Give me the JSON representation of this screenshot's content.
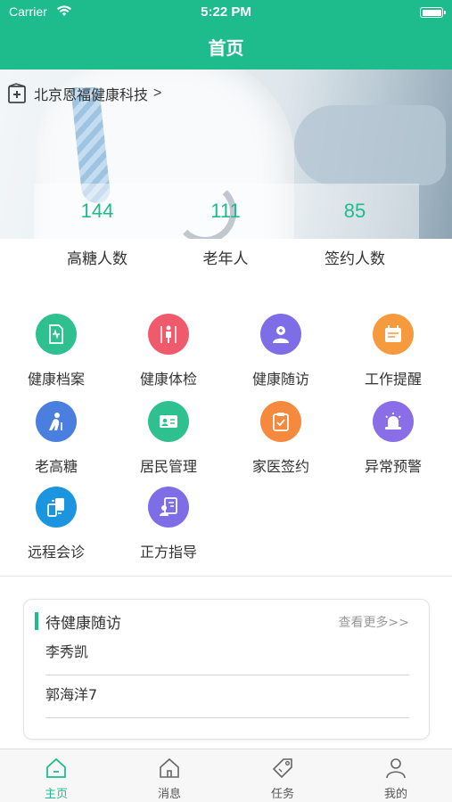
{
  "status": {
    "carrier": "Carrier",
    "time": "5:22 PM"
  },
  "nav": {
    "title": "首页"
  },
  "banner": {
    "org_name": "北京恩福健康科技",
    "org_arrow": ">",
    "stats": [
      {
        "value": "144",
        "label": "高糖人数"
      },
      {
        "value": "111",
        "label": "老年人"
      },
      {
        "value": "85",
        "label": "签约人数"
      }
    ]
  },
  "grid": [
    {
      "label": "健康档案",
      "icon": "health-record-icon",
      "color": "#2ec08e"
    },
    {
      "label": "健康体检",
      "icon": "physical-exam-icon",
      "color": "#ef5a6c"
    },
    {
      "label": "健康随访",
      "icon": "doctor-followup-icon",
      "color": "#7d6ee8"
    },
    {
      "label": "工作提醒",
      "icon": "work-reminder-icon",
      "color": "#f59b3d"
    },
    {
      "label": "老高糖",
      "icon": "elderly-icon",
      "color": "#4a7fe0"
    },
    {
      "label": "居民管理",
      "icon": "resident-card-icon",
      "color": "#2ec08e"
    },
    {
      "label": "家医签约",
      "icon": "contract-clipboard-icon",
      "color": "#f5893d"
    },
    {
      "label": "异常预警",
      "icon": "alarm-icon",
      "color": "#8a6ee8"
    },
    {
      "label": "远程会诊",
      "icon": "remote-consult-icon",
      "color": "#1b95e0"
    },
    {
      "label": "正方指导",
      "icon": "guidance-icon",
      "color": "#7d6ee8"
    }
  ],
  "followup": {
    "title": "待健康随访",
    "more": "查看更多>>",
    "items": [
      "李秀凯",
      "郭海洋7"
    ]
  },
  "tabs": [
    {
      "label": "主页",
      "icon": "home-icon",
      "active": true
    },
    {
      "label": "消息",
      "icon": "message-home-icon",
      "active": false
    },
    {
      "label": "任务",
      "icon": "task-tag-icon",
      "active": false
    },
    {
      "label": "我的",
      "icon": "profile-icon",
      "active": false
    }
  ],
  "colors": {
    "accent": "#1ebc8c"
  }
}
